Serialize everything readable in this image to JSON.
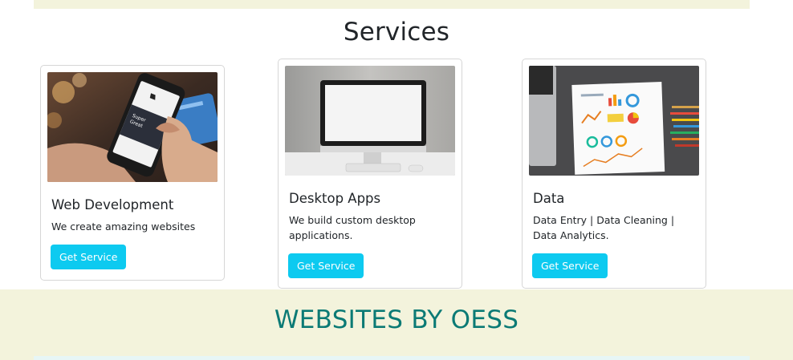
{
  "services": {
    "title": "Services",
    "cards": [
      {
        "title": "Web Development",
        "text": "We create amazing websites",
        "button": "Get Service",
        "image_icon": "phone-shopping-image"
      },
      {
        "title": "Desktop Apps",
        "text": "We build custom desktop applications.",
        "button": "Get Service",
        "image_icon": "desktop-monitor-image"
      },
      {
        "title": "Data",
        "text": "Data Entry | Data Cleaning | Data Analytics.",
        "button": "Get Service",
        "image_icon": "data-charts-image"
      }
    ]
  },
  "portfolio": {
    "title": "WEBSITES BY OESS"
  },
  "colors": {
    "accent": "#0dcaf0",
    "band": "#f3f3dc",
    "heading_teal": "#0b7a75"
  }
}
